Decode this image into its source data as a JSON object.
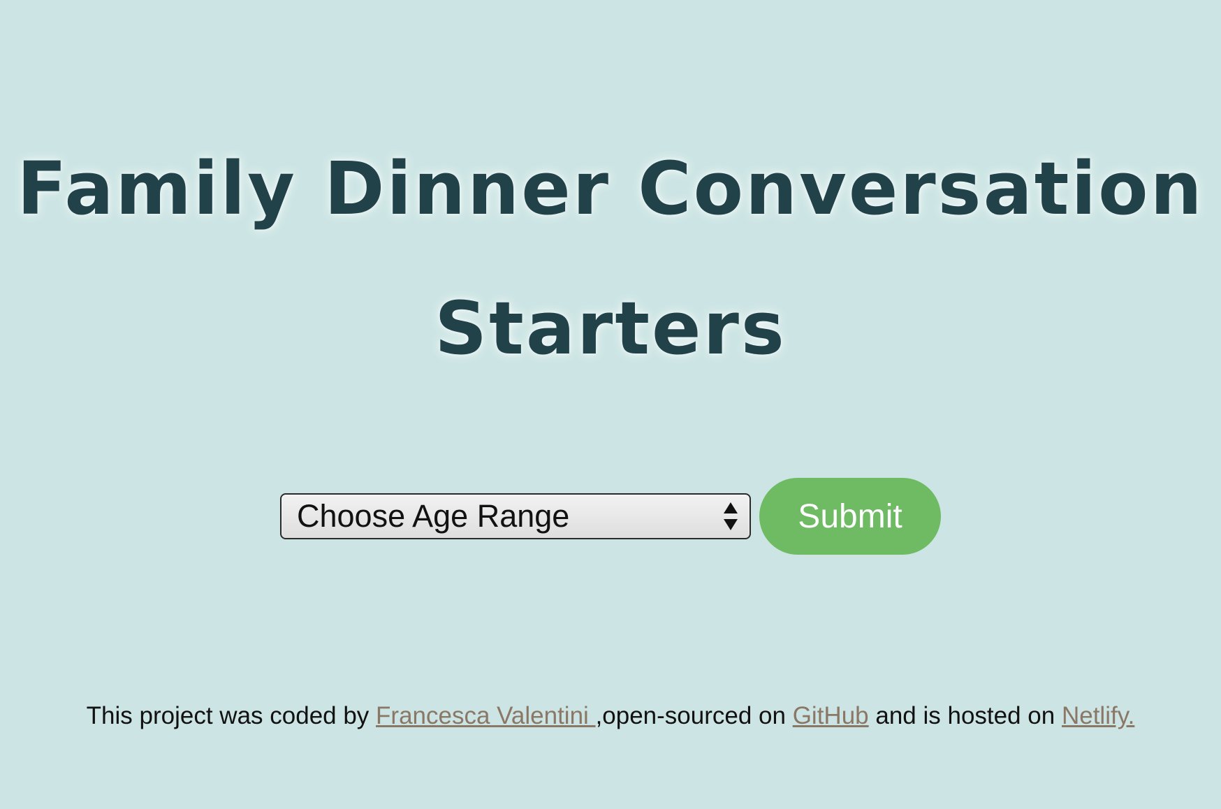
{
  "page": {
    "title_line1": "Family Dinner Conversation",
    "title_line2": "Starters"
  },
  "form": {
    "select_value": "Choose Age Range",
    "submit_label": "Submit"
  },
  "footer": {
    "text_1": "This project was coded by ",
    "author_link": "Francesca Valentini ",
    "text_2": ",open-sourced on ",
    "github_link": "GitHub",
    "text_3": " and is hosted on ",
    "netlify_link": "Netlify."
  },
  "colors": {
    "background": "#cce5e4",
    "title": "#22424a",
    "button": "#6ebb63",
    "link": "#8a7766"
  },
  "icons": {
    "select_arrows": "up-down-chevron-icon"
  }
}
